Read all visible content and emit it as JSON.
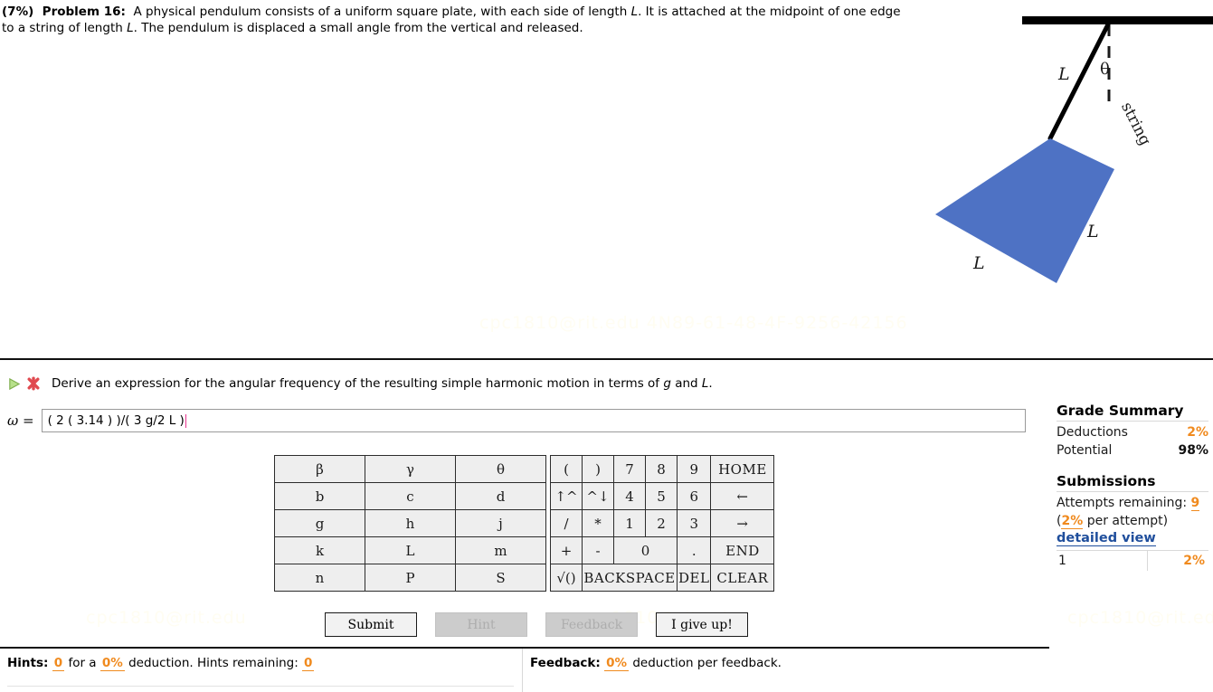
{
  "problem": {
    "percent": "(7%)",
    "label": "Problem 16:",
    "body_part1": "A physical pendulum consists of a uniform square plate, with each side of length ",
    "var_L1": "L",
    "body_part2": ". It is attached at the midpoint of one edge to a string of length ",
    "var_L2": "L",
    "body_part3": ". The pendulum is displaced a small angle from the vertical and released."
  },
  "figure": {
    "label_string": "string",
    "label_theta": "θ",
    "label_L_string": "L",
    "label_L_right": "L",
    "label_L_bottom": "L",
    "plate_color": "#4e72c4",
    "ceiling_color": "#000000"
  },
  "question": {
    "text_part1": "Derive an expression for the angular frequency of the resulting simple harmonic motion in terms of ",
    "var_g": "g",
    "text_and": " and ",
    "var_L": "L",
    "text_end": ".",
    "status_play_icon": "play-triangle-icon",
    "status_incorrect_icon": "red-x-incorrect-icon"
  },
  "answer": {
    "variable_label": "ω =",
    "value": "( 2 ( 3.14 ) )/( 3 g/2 L )",
    "placeholder": ""
  },
  "keypad": {
    "letters": [
      [
        "β",
        "γ",
        "θ"
      ],
      [
        "b",
        "c",
        "d"
      ],
      [
        "g",
        "h",
        "j"
      ],
      [
        "k",
        "L",
        "m"
      ],
      [
        "n",
        "P",
        "S"
      ]
    ],
    "row1": [
      {
        "label": "(",
        "disabled": false
      },
      {
        "label": ")",
        "disabled": true
      },
      {
        "label": "7",
        "disabled": false
      },
      {
        "label": "8",
        "disabled": false
      },
      {
        "label": "9",
        "disabled": false
      },
      {
        "label": "HOME",
        "disabled": false
      }
    ],
    "row2": [
      {
        "label": "↑^",
        "disabled": false
      },
      {
        "label": "^↓",
        "disabled": true
      },
      {
        "label": "4",
        "disabled": false
      },
      {
        "label": "5",
        "disabled": false
      },
      {
        "label": "6",
        "disabled": false
      },
      {
        "label": "←",
        "disabled": false
      }
    ],
    "row3": [
      {
        "label": "/",
        "disabled": false
      },
      {
        "label": "*",
        "disabled": true
      },
      {
        "label": "1",
        "disabled": false
      },
      {
        "label": "2",
        "disabled": false
      },
      {
        "label": "3",
        "disabled": false
      },
      {
        "label": "→",
        "disabled": false
      }
    ],
    "row4": [
      {
        "label": "+",
        "disabled": false
      },
      {
        "label": "-",
        "disabled": false
      },
      {
        "label": "0",
        "disabled": false
      },
      {
        "label": ".",
        "disabled": false
      },
      {
        "label": "END",
        "disabled": false
      }
    ],
    "row5": [
      {
        "label": "√()",
        "disabled": false
      },
      {
        "label": "BACKSPACE",
        "disabled": false
      },
      {
        "label": "DEL",
        "disabled": false
      },
      {
        "label": "CLEAR",
        "disabled": false
      }
    ]
  },
  "buttons": {
    "submit": "Submit",
    "hint": "Hint",
    "feedback": "Feedback",
    "give_up": "I give up!"
  },
  "hints_bar": {
    "hints_label": "Hints:",
    "hints_count": "0",
    "for_a": "for a",
    "hints_deduction": "0%",
    "deduction_text": "deduction. Hints remaining:",
    "hints_remaining": "0",
    "feedback_label": "Feedback:",
    "feedback_deduction": "0%",
    "feedback_text": "deduction per feedback."
  },
  "grade_summary": {
    "title": "Grade Summary",
    "deductions_label": "Deductions",
    "deductions_value": "2%",
    "potential_label": "Potential",
    "potential_value": "98%",
    "submissions_title": "Submissions",
    "attempts_label": "Attempts remaining:",
    "attempts_value": "9",
    "per_attempt_open": "(",
    "per_attempt_value": "2%",
    "per_attempt_text": " per attempt)",
    "detailed_view": "detailed view",
    "rows": [
      {
        "index": "1",
        "value": "2%"
      }
    ]
  },
  "watermark": {
    "text_full": "cpc1810@rit.edu 4N89-61-48-4F-9256-42156",
    "text_short": "cpc1810@rit.edu"
  },
  "colors": {
    "orange": "#f08a1e",
    "link_blue": "#1f4e9c",
    "plate_blue": "#4e72c4"
  }
}
